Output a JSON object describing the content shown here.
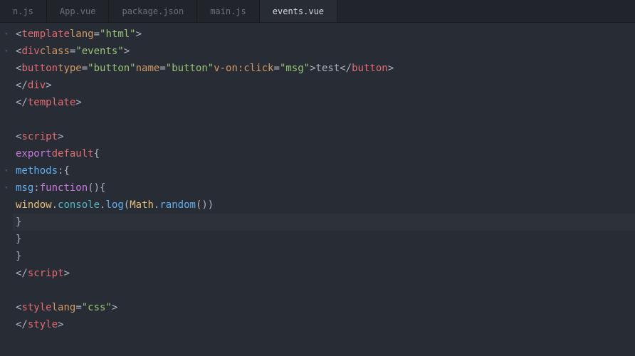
{
  "tabs": [
    {
      "label": "n.js",
      "active": false
    },
    {
      "label": "App.vue",
      "active": false
    },
    {
      "label": "package.json",
      "active": false
    },
    {
      "label": "main.js",
      "active": false
    },
    {
      "label": "events.vue",
      "active": true
    }
  ],
  "code": {
    "l1": {
      "tag": "template",
      "attr": "lang",
      "val": "\"html\""
    },
    "l2": {
      "tag": "div",
      "attr": "class",
      "val": "\"events\""
    },
    "l3": {
      "tag": "button",
      "a1": "type",
      "v1": "\"button\"",
      "a2": "name",
      "v2": "\"button\"",
      "a3": "v-on:click",
      "v3": "\"msg\"",
      "text": "test",
      "close": "button"
    },
    "l4": {
      "close": "div"
    },
    "l5": {
      "close": "template"
    },
    "l7": {
      "tag": "script"
    },
    "l8": {
      "kw1": "export",
      "kw2": "default",
      "brace": "{"
    },
    "l9": {
      "prop": "methods",
      "rest": ":{"
    },
    "l10": {
      "prop": "msg",
      "colon": ":",
      "fn": "function",
      "rest": "(){"
    },
    "l11": {
      "obj1": "window",
      "d1": ".",
      "obj2": "console",
      "d2": ".",
      "m1": "log",
      "p1": "(",
      "obj3": "Math",
      "d3": ".",
      "m2": "random",
      "p2": "())"
    },
    "l12": {
      "brace": "}"
    },
    "l13": {
      "brace": "}"
    },
    "l14": {
      "brace": "}"
    },
    "l15": {
      "close": "script"
    },
    "l17": {
      "tag": "style",
      "attr": "lang",
      "val": "\"css\""
    },
    "l18": {
      "close": "style"
    }
  }
}
